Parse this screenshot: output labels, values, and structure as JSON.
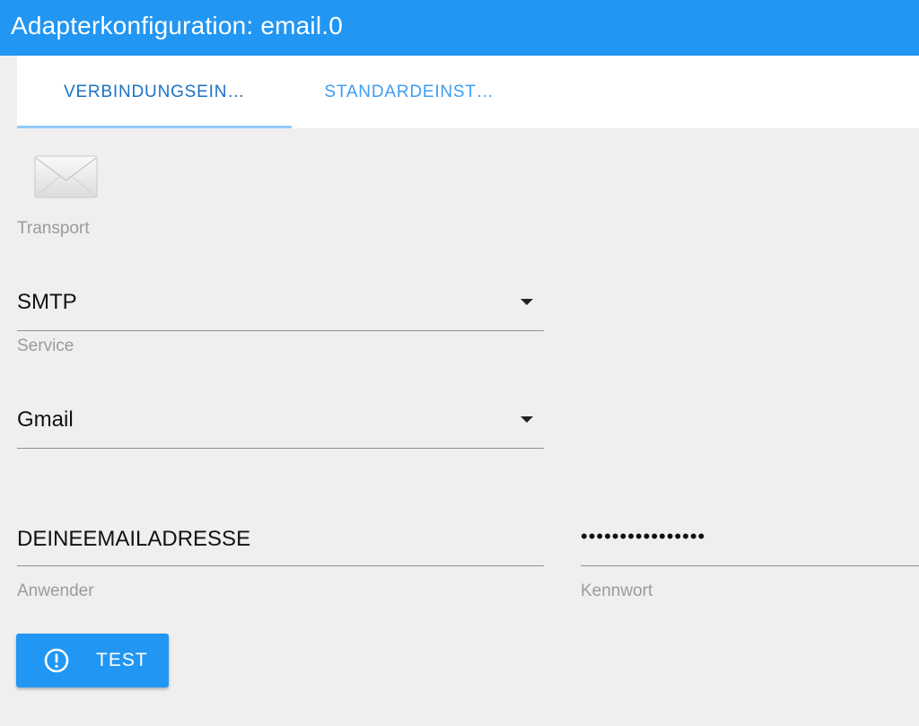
{
  "header": {
    "title": "Adapterkonfiguration: email.0"
  },
  "tabs": [
    {
      "label": "VERBINDUNGSEIN…",
      "active": true
    },
    {
      "label": "STANDARDEINST…",
      "active": false
    }
  ],
  "form": {
    "transport": {
      "label": "Transport",
      "value": "SMTP"
    },
    "service": {
      "label": "Service",
      "value": "Gmail"
    },
    "user": {
      "label": "Anwender",
      "value": "DEINEEMAILADRESSE"
    },
    "password": {
      "label": "Kennwort",
      "masked": "••••••••••••••••"
    }
  },
  "test_button": {
    "label": "TEST",
    "icon": "alert-circle-icon"
  },
  "icons": {
    "adapter_logo": "envelope-icon"
  },
  "colors": {
    "primary": "#2196f3",
    "background": "#efefef",
    "tab_indicator": "#90caf9"
  }
}
